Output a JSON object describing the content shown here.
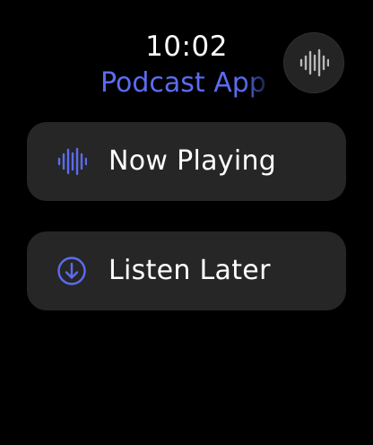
{
  "status": {
    "time": "10:02"
  },
  "header": {
    "app_title": "Podcast App"
  },
  "voice_button": {
    "icon": "waveform-icon"
  },
  "menu": {
    "items": [
      {
        "label": "Now Playing",
        "icon": "waveform-icon"
      },
      {
        "label": "Listen Later",
        "icon": "download-circle-icon"
      }
    ]
  },
  "colors": {
    "accent": "#5b6cf0",
    "background": "#000000",
    "card": "#262626",
    "voice_button_bg": "#242424",
    "voice_icon": "#b8b8b8",
    "text": "#ffffff"
  }
}
